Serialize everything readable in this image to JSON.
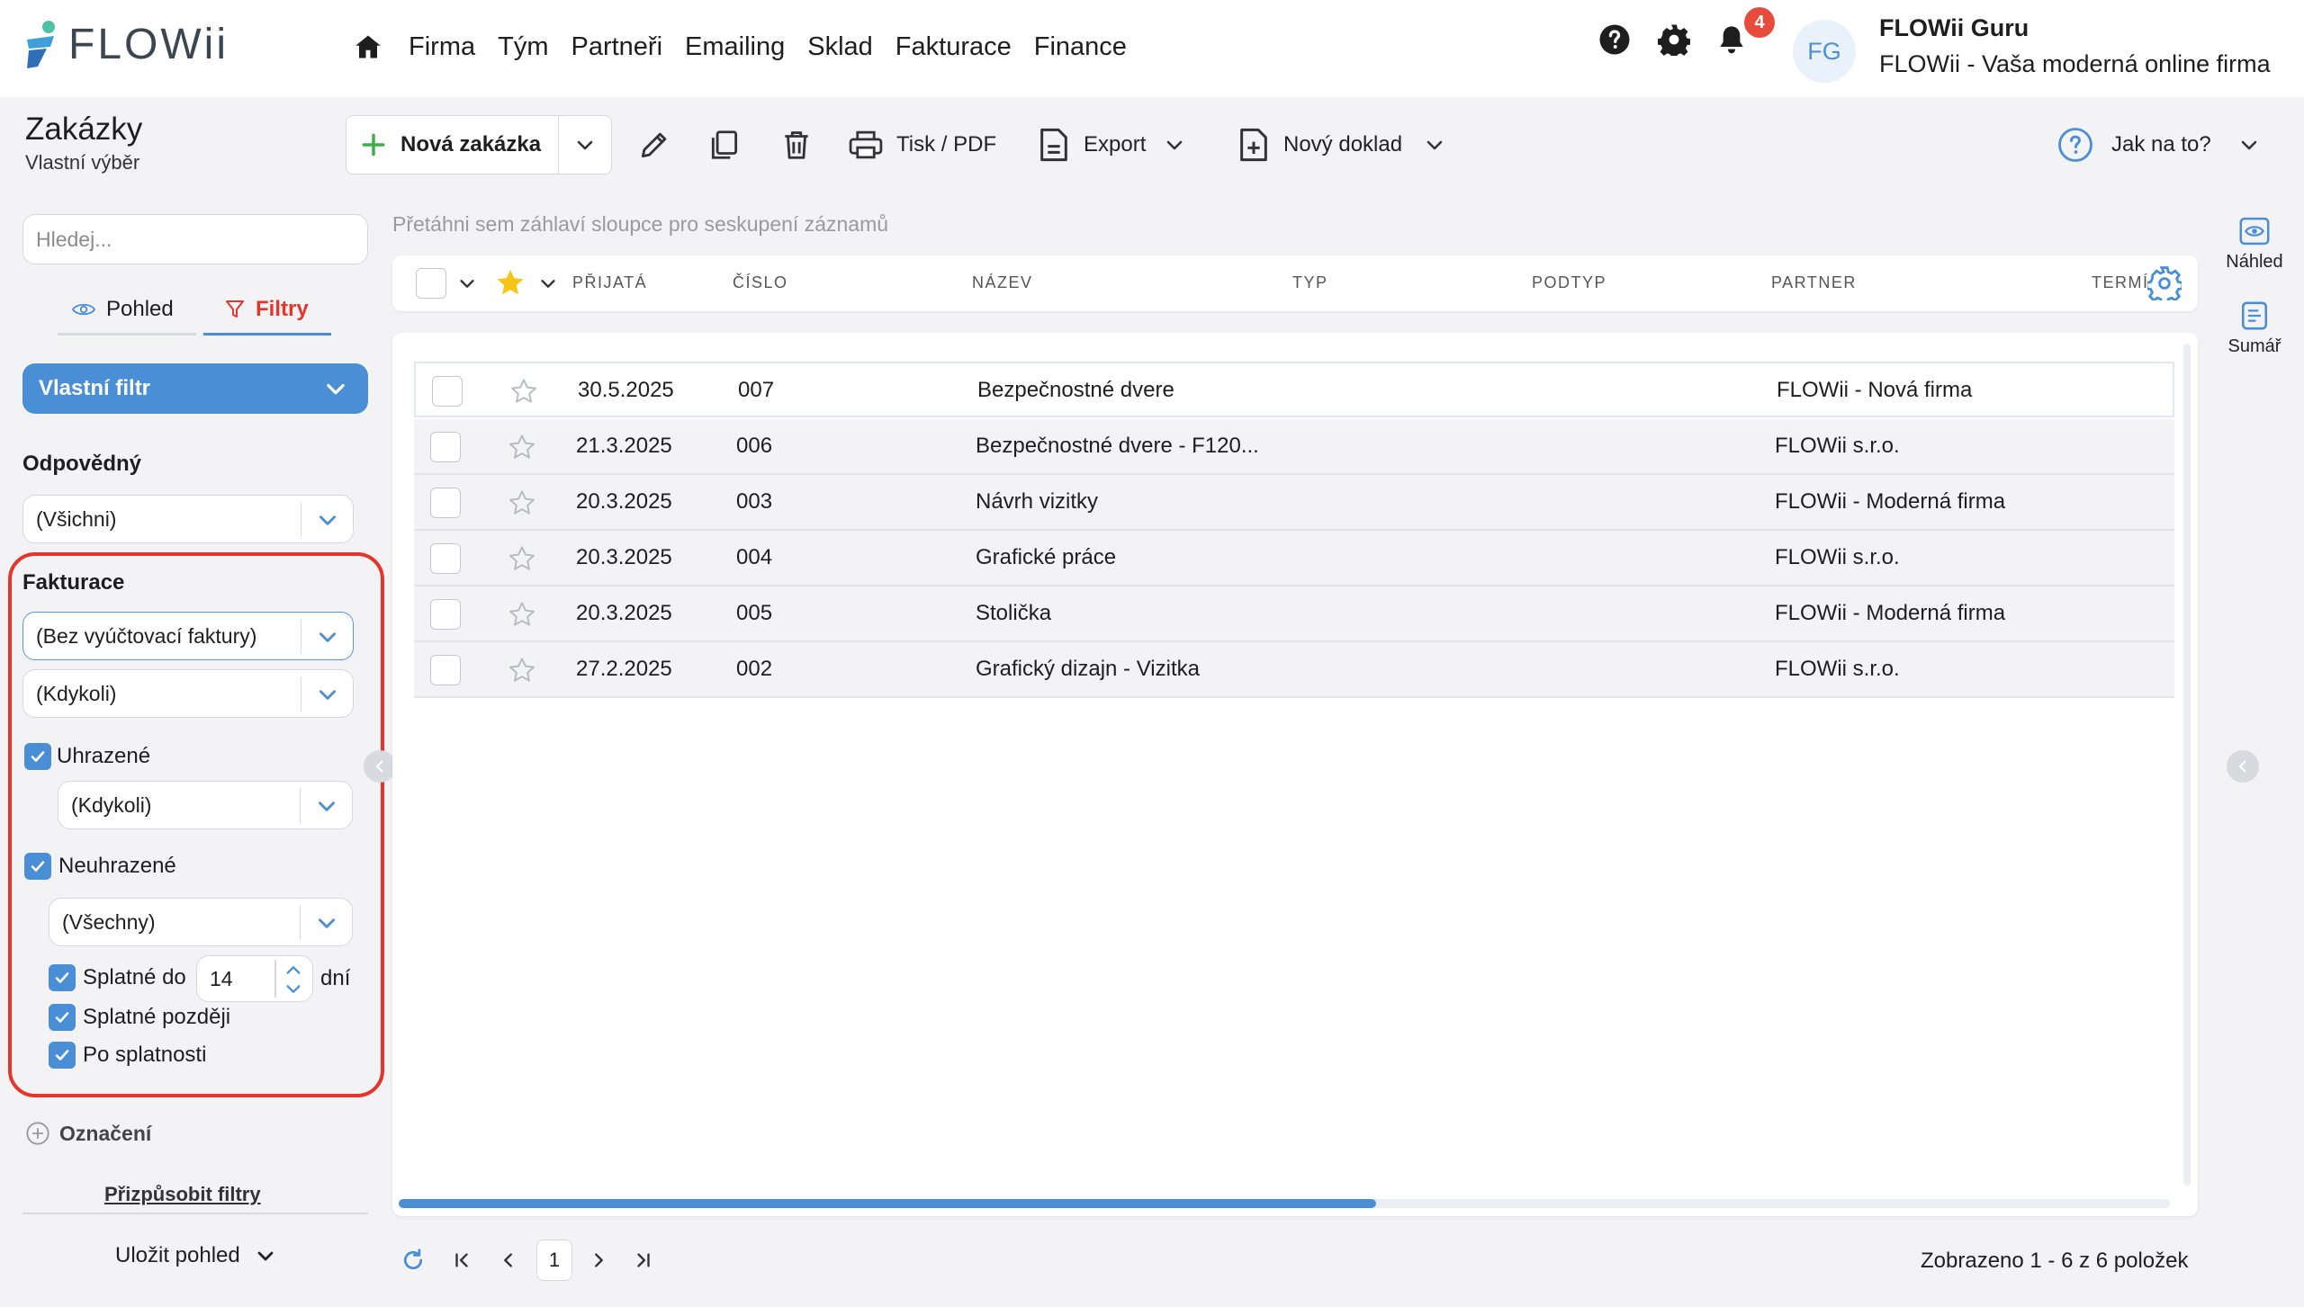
{
  "app": {
    "logo_text": "FLOWii"
  },
  "nav": {
    "items": [
      "Firma",
      "Tým",
      "Partneři",
      "Emailing",
      "Sklad",
      "Fakturace",
      "Finance"
    ]
  },
  "notifications": {
    "count": "4"
  },
  "user": {
    "initials": "FG",
    "name": "FLOWii Guru",
    "company": "FLOWii - Vaša moderná online firma"
  },
  "page": {
    "title": "Zakázky",
    "subtitle": "Vlastní výběr"
  },
  "toolbar": {
    "new_label": "Nová zakázka",
    "print_label": "Tisk / PDF",
    "export_label": "Export",
    "new_doc_label": "Nový doklad",
    "help_label": "Jak na to?"
  },
  "sidebar": {
    "search_placeholder": "Hledej...",
    "tabs": {
      "view": "Pohled",
      "filters": "Filtry"
    },
    "custom_filter": "Vlastní filtr",
    "responsible": {
      "label": "Odpovědný",
      "value": "(Všichni)"
    },
    "invoicing": {
      "label": "Fakturace",
      "invoice_value": "(Bez vyúčtovací faktury)",
      "time_value": "(Kdykoli)",
      "paid_label": "Uhrazené",
      "paid_time_value": "(Kdykoli)",
      "unpaid_label": "Neuhrazené",
      "unpaid_value": "(Všechny)",
      "due_within_label": "Splatné do",
      "due_within_value": "14",
      "days_label": "dní",
      "due_later_label": "Splatné později",
      "overdue_label": "Po splatnosti"
    },
    "tagged_label": "Označení",
    "customize_filters": "Přizpůsobit filtry",
    "save_view": "Uložit pohled"
  },
  "grid": {
    "drag_hint": "Přetáhni sem záhlaví sloupce pro seskupení záznamů",
    "columns": [
      "PŘIJATÁ",
      "ČÍSLO",
      "NÁZEV",
      "TYP",
      "PODTYP",
      "PARTNER",
      "TERMÍ"
    ],
    "rows": [
      {
        "date": "30.5.2025",
        "number": "007",
        "name": "Bezpečnostné dvere",
        "partner": "FLOWii - Nová firma"
      },
      {
        "date": "21.3.2025",
        "number": "006",
        "name": "Bezpečnostné dvere - F120...",
        "partner": "FLOWii s.r.o."
      },
      {
        "date": "20.3.2025",
        "number": "003",
        "name": "Návrh vizitky",
        "partner": "FLOWii - Moderná firma"
      },
      {
        "date": "20.3.2025",
        "number": "004",
        "name": "Grafické práce",
        "partner": "FLOWii s.r.o."
      },
      {
        "date": "20.3.2025",
        "number": "005",
        "name": "Stolička",
        "partner": "FLOWii - Moderná firma"
      },
      {
        "date": "27.2.2025",
        "number": "002",
        "name": "Grafický dizajn - Vizitka",
        "partner": "FLOWii s.r.o."
      }
    ]
  },
  "pager": {
    "page": "1",
    "info": "Zobrazeno 1 - 6 z 6 položek"
  },
  "right_rail": {
    "preview": "Náhled",
    "summary": "Sumář"
  },
  "colors": {
    "accent": "#4a8ed6",
    "highlight": "#e5342b",
    "badge": "#e64b3c",
    "star": "#f5c518"
  }
}
